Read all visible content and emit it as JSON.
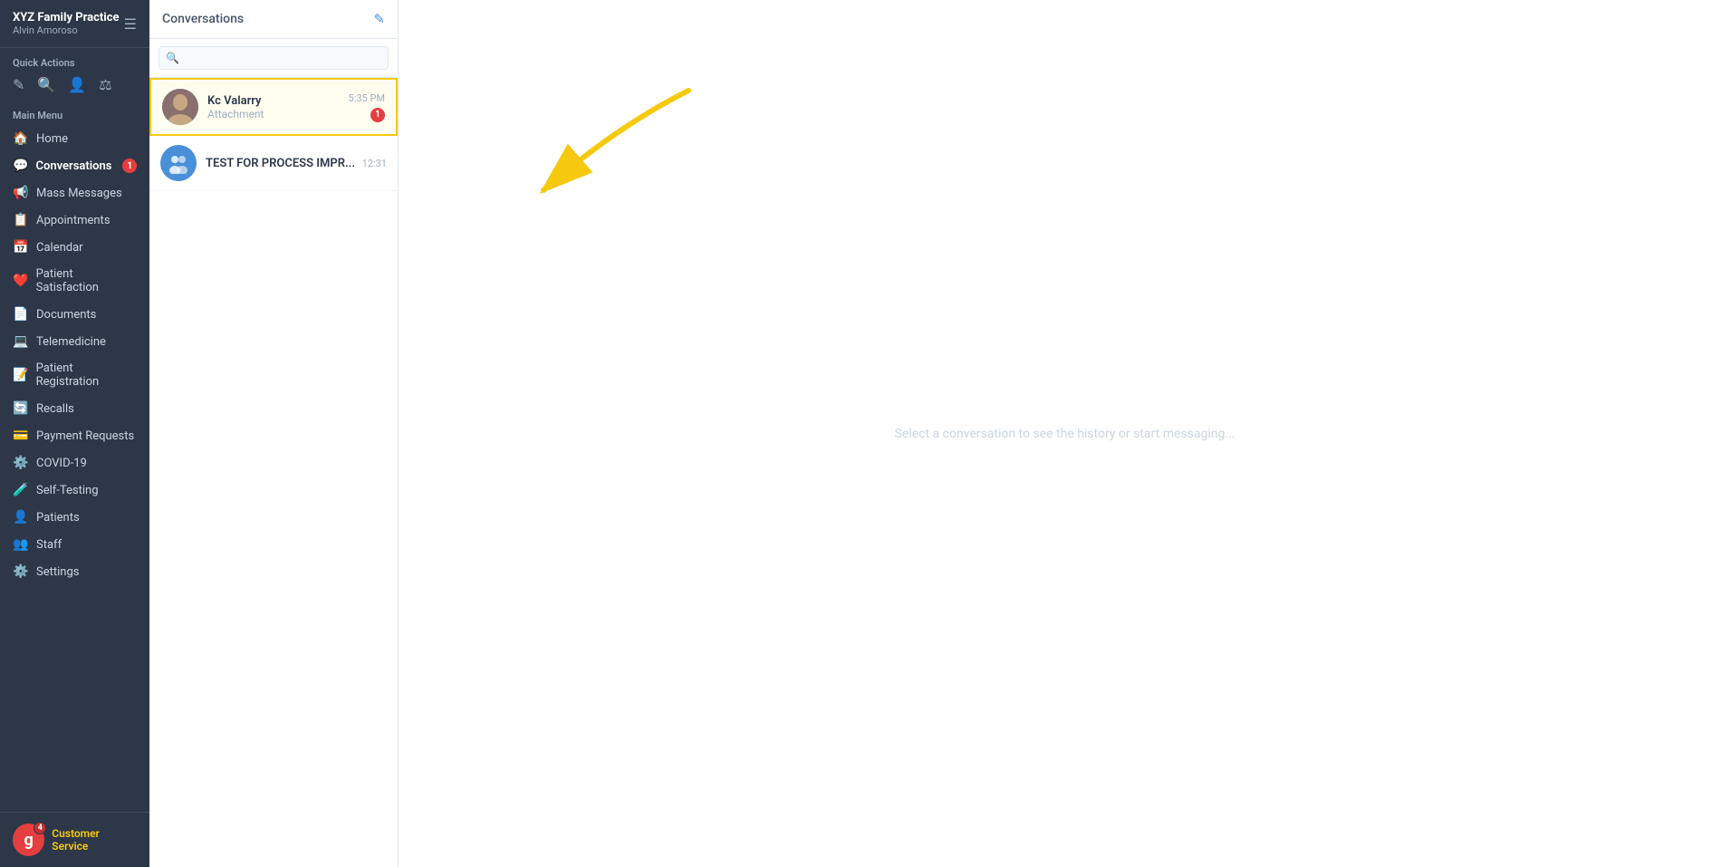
{
  "sidebar": {
    "brand": {
      "name": "XYZ Family Practice",
      "user": "Alvin Amoroso"
    },
    "quick_actions_label": "Quick Actions",
    "main_menu_label": "Main Menu",
    "nav_items": [
      {
        "id": "home",
        "label": "Home",
        "icon": "🏠",
        "badge": null
      },
      {
        "id": "conversations",
        "label": "Conversations",
        "icon": "💬",
        "badge": "1",
        "active": true
      },
      {
        "id": "mass-messages",
        "label": "Mass Messages",
        "icon": "📢",
        "badge": null
      },
      {
        "id": "appointments",
        "label": "Appointments",
        "icon": "📋",
        "badge": null
      },
      {
        "id": "calendar",
        "label": "Calendar",
        "icon": "📅",
        "badge": null
      },
      {
        "id": "patient-satisfaction",
        "label": "Patient Satisfaction",
        "icon": "❤️",
        "badge": null
      },
      {
        "id": "documents",
        "label": "Documents",
        "icon": "📄",
        "badge": null
      },
      {
        "id": "telemedicine",
        "label": "Telemedicine",
        "icon": "💻",
        "badge": null
      },
      {
        "id": "patient-registration",
        "label": "Patient Registration",
        "icon": "📝",
        "badge": null
      },
      {
        "id": "recalls",
        "label": "Recalls",
        "icon": "🔄",
        "badge": null
      },
      {
        "id": "payment-requests",
        "label": "Payment Requests",
        "icon": "💳",
        "badge": null
      },
      {
        "id": "covid-19",
        "label": "COVID-19",
        "icon": "⚙️",
        "badge": null
      },
      {
        "id": "self-testing",
        "label": "Self-Testing",
        "icon": "🧪",
        "badge": null
      },
      {
        "id": "patients",
        "label": "Patients",
        "icon": "👤",
        "badge": null
      },
      {
        "id": "staff",
        "label": "Staff",
        "icon": "👥",
        "badge": null
      },
      {
        "id": "settings",
        "label": "Settings",
        "icon": "⚙️",
        "badge": null
      }
    ],
    "footer": {
      "badge_count": "4",
      "customer_service_label": "Customer Service"
    }
  },
  "conversations_panel": {
    "title": "Conversations",
    "search_placeholder": "🔍",
    "new_conv_icon": "✏️",
    "items": [
      {
        "id": "kc-valarry",
        "name": "Kc Valarry",
        "last_message": "Attachment",
        "time": "5:35 PM",
        "unread": "1",
        "highlighted": true,
        "has_avatar": true
      },
      {
        "id": "test-process",
        "name": "TEST FOR PROCESS IMPR...",
        "last_message": "",
        "time": "12:31",
        "unread": null,
        "highlighted": false,
        "has_avatar": false,
        "is_group": true
      }
    ]
  },
  "main_content": {
    "empty_state": "Select a conversation to see the history or start messaging..."
  }
}
